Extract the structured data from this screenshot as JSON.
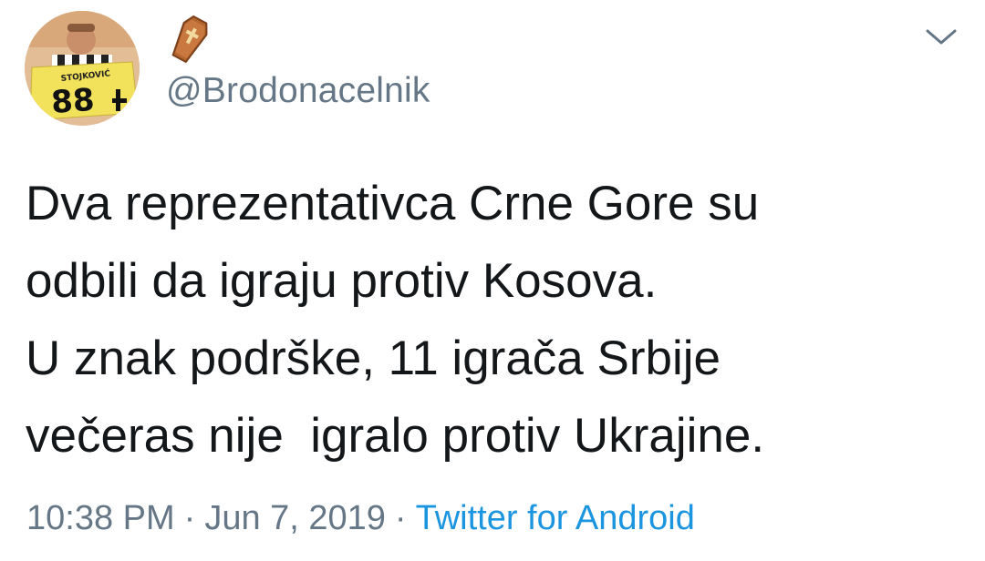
{
  "user": {
    "handle": "@Brodonacelnik",
    "display_name_icon": "coffin-icon",
    "avatar_jersey_text": "STOJKOVIĆ",
    "avatar_jersey_number": "88"
  },
  "tweet": {
    "lines": [
      "Dva reprezentativca Crne Gore su",
      "odbili da igraju protiv Kosova.",
      "U znak podrške, 11 igrača Srbije",
      "večeras nije  igralo protiv Ukrajine."
    ],
    "time": "10:38 PM",
    "separator": "·",
    "date": "Jun 7, 2019",
    "source": "Twitter for Android"
  },
  "icons": {
    "menu": "chevron-down-icon"
  },
  "colors": {
    "text": "#14171a",
    "muted": "#657786",
    "link": "#1b95e0",
    "coffin": "#b5652e"
  }
}
